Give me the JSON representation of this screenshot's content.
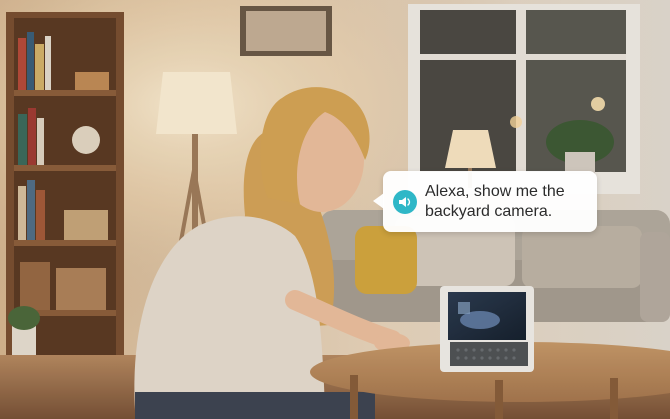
{
  "speech_bubble": {
    "text": "Alexa, show me the\nbackyard camera.",
    "icon": "speaker-icon",
    "accent_color": "#2fb7c7"
  }
}
